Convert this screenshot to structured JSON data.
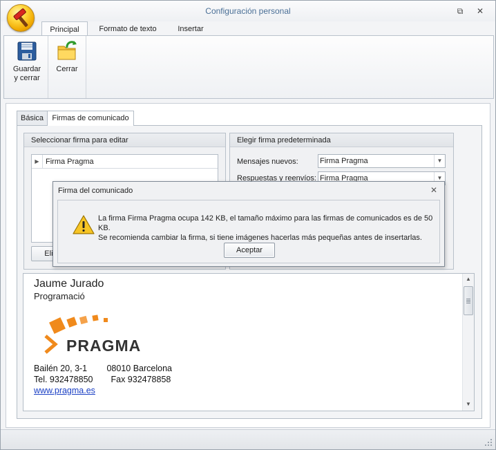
{
  "window": {
    "title": "Configuración personal",
    "restore_symbol": "⧉",
    "close_symbol": "✕"
  },
  "ribbon": {
    "tabs": [
      "Principal",
      "Formato de texto",
      "Insertar"
    ],
    "active_tab": "Principal",
    "buttons": [
      {
        "label_line1": "Guardar",
        "label_line2": "y cerrar",
        "icon": "floppy-disk-icon"
      },
      {
        "label_line1": "Cerrar",
        "label_line2": "",
        "icon": "folder-close-icon"
      }
    ]
  },
  "page_tabs": [
    "Básica",
    "Firmas de comunicado"
  ],
  "active_page_tab": "Firmas de comunicado",
  "select_group": {
    "title": "Seleccionar firma para editar",
    "rows": [
      "Firma Pragma"
    ],
    "delete_button": "Elim"
  },
  "default_group": {
    "title": "Elegir firma predeterminada",
    "new_messages_label": "Mensajes nuevos:",
    "new_messages_value": "Firma Pragma",
    "replies_label": "Respuestas y reenvíos:",
    "replies_value": "Firma Pragma"
  },
  "signature": {
    "name": "Jaume Jurado",
    "role": "Programació",
    "logo_text": "PRAGMA",
    "address": "Bailén 20, 3-1",
    "postal": "08010 Barcelona",
    "phone": "Tel. 932478850",
    "fax": "Fax  932478858",
    "website": "www.pragma.es",
    "logo_color": "#f08a1c"
  },
  "dialog": {
    "title": "Firma del comunicado",
    "close_symbol": "✕",
    "message_line1": "La firma Firma Pragma ocupa 142 KB, el tamaño máximo para las firmas de comunicados es de 50 KB.",
    "message_line2": "Se recomienda cambiar la firma, si tiene imágenes hacerlas más pequeñas antes de insertarlas.",
    "ok_button": "Aceptar",
    "icon": "warning-icon"
  }
}
